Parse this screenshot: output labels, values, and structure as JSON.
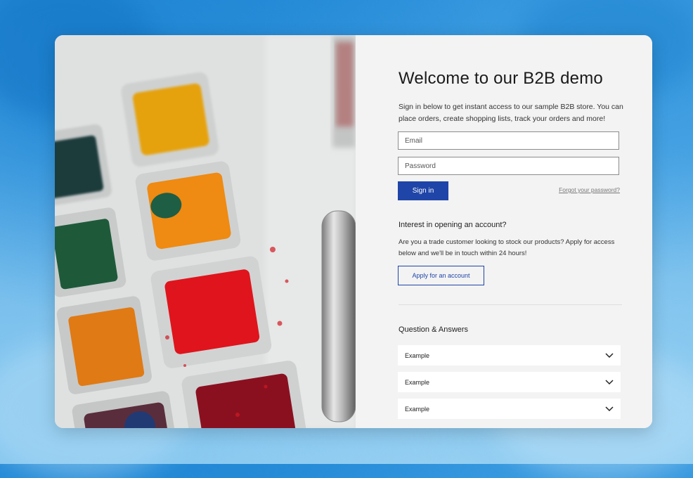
{
  "login": {
    "title": "Welcome to our B2B demo",
    "intro": "Sign in below to get instant access to our sample B2B store. You can place orders, create shopping lists, track your orders and more!",
    "email_placeholder": "Email",
    "password_placeholder": "Password",
    "sign_in_label": "Sign in",
    "forgot_label": "Forgot your password?"
  },
  "account": {
    "heading": "Interest in opening an account?",
    "description": "Are you a trade customer looking to stock our products? Apply for access below and we'll be in touch within 24 hours!",
    "apply_label": "Apply for an account"
  },
  "faq": {
    "heading": "Question & Answers",
    "items": [
      {
        "label": "Example"
      },
      {
        "label": "Example"
      },
      {
        "label": "Example"
      }
    ]
  },
  "colors": {
    "primary": "#1f45a8",
    "panel": "#f3f3f3",
    "background": "#2b8fda"
  },
  "icons": {
    "accordion": "chevron-down-icon",
    "hero": "watercolor-palette-image"
  }
}
